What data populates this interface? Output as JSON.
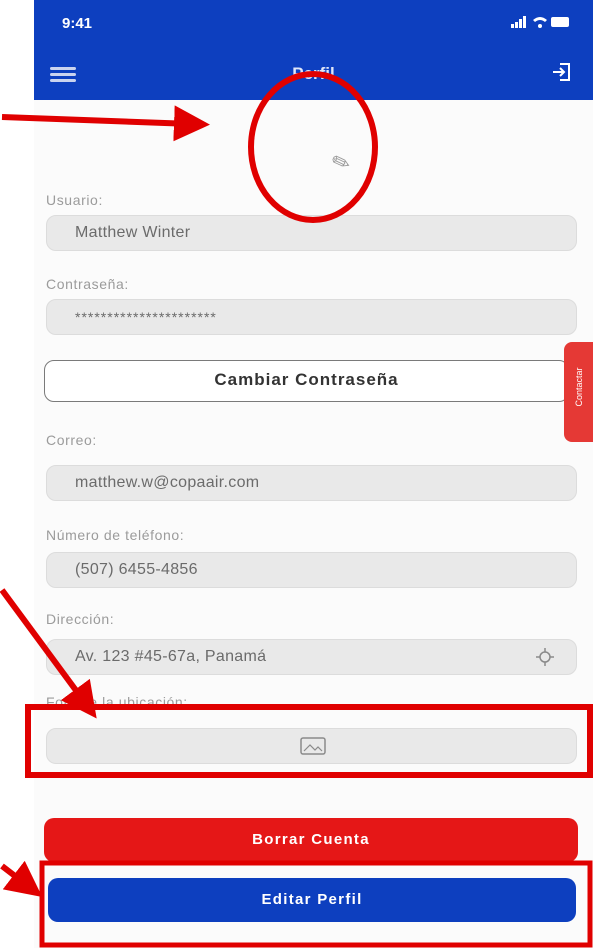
{
  "status_bar": {
    "time": "9:41",
    "icons": "signal-icon wifi-icon battery-icon"
  },
  "app_bar": {
    "title": "Perfil",
    "menu_icon": "menu-icon",
    "logout_icon": "logout-icon"
  },
  "avatar": {
    "edit_icon": "pencil-icon"
  },
  "form": {
    "user_label": "Usuario:",
    "user_value": "Matthew Winter",
    "password_label": "Contraseña:",
    "password_value": "**********************",
    "change_password": "Cambiar Contraseña",
    "email_label": "Correo:",
    "email_value": "matthew.w@copaair.com",
    "phone_label": "Número de teléfono:",
    "phone_value": "(507) 6455-4856",
    "address_label": "Dirección:",
    "address_value": "Av. 123 #45-67a, Panamá",
    "photo_label": "Foto de la ubicación:"
  },
  "contact_tab": {
    "label": "Contactar"
  },
  "buttons": {
    "delete": "Borrar Cuenta",
    "edit": "Editar Perfil"
  },
  "colors": {
    "primary": "#0d3fbf",
    "danger": "#e51717",
    "annotation": "#ff0000"
  }
}
